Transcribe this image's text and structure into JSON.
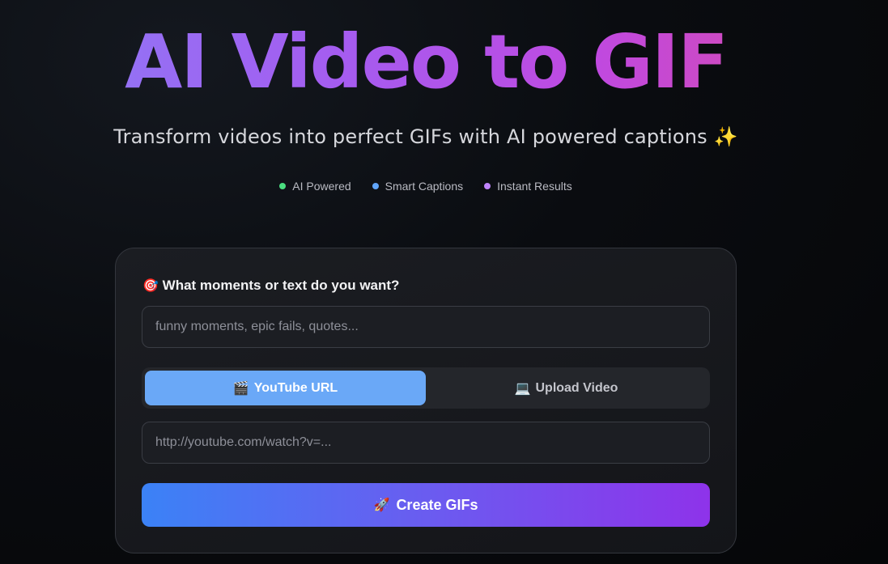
{
  "hero": {
    "title": "AI Video to GIF",
    "subtitle": "Transform videos into perfect GIFs with AI powered captions ✨"
  },
  "features": [
    {
      "label": "AI Powered",
      "color": "#4ade80"
    },
    {
      "label": "Smart Captions",
      "color": "#60a5fa"
    },
    {
      "label": "Instant Results",
      "color": "#c084fc"
    }
  ],
  "form": {
    "prompt_label": "What moments or text do you want?",
    "prompt_icon": "🎯",
    "moments_placeholder": "funny moments, epic fails, quotes...",
    "moments_value": "",
    "tabs": [
      {
        "label": "YouTube URL",
        "icon": "🎬",
        "active": true
      },
      {
        "label": "Upload Video",
        "icon": "💻",
        "active": false
      }
    ],
    "url_placeholder": "http://youtube.com/watch?v=...",
    "url_value": "",
    "submit_label": "Create GIFs",
    "submit_icon": "🚀"
  }
}
